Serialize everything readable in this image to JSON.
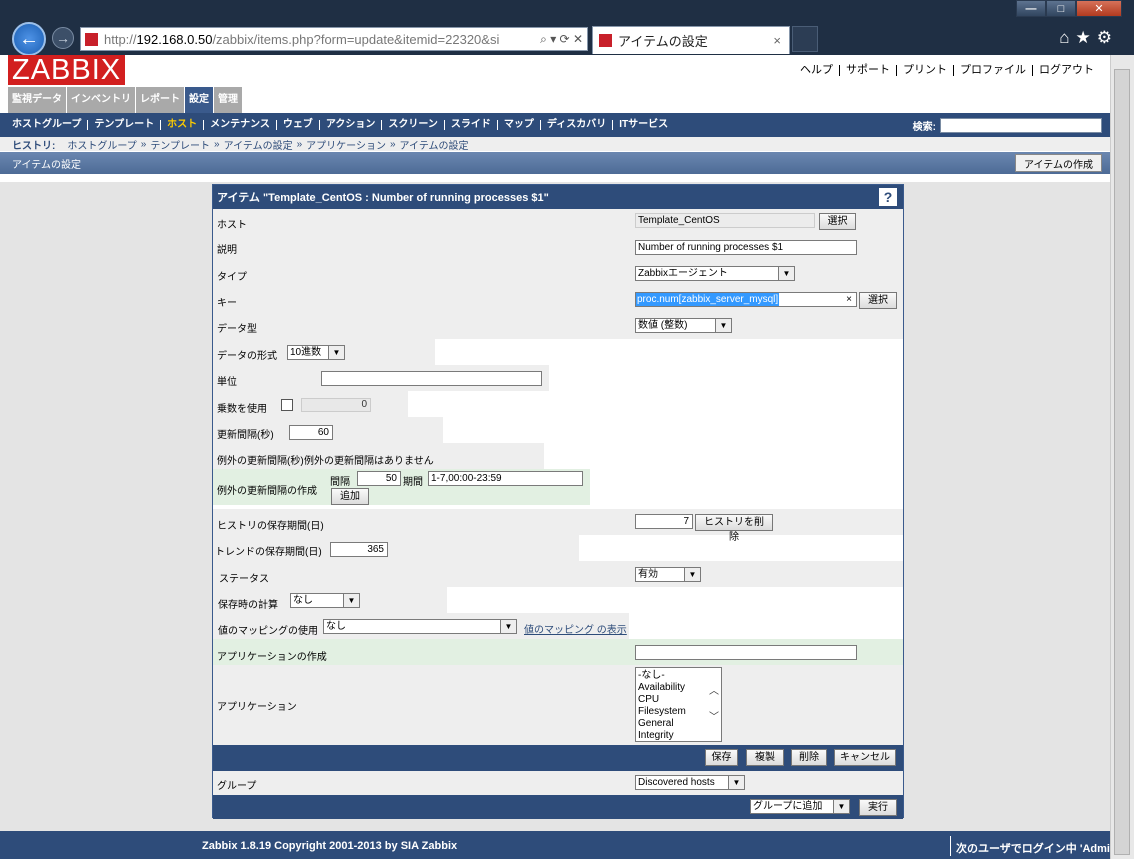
{
  "browser": {
    "url_prefix": "http://",
    "url_host": "192.168.0.50",
    "url_path": "/zabbix/items.php?form=update&itemid=22320&si",
    "tab_title": "アイテムの設定",
    "url_tools": "⌕ ▾ ⟳ ✕",
    "tab_close": "×"
  },
  "window_controls": {
    "min": "—",
    "max": "□",
    "close": "✕"
  },
  "nav_icons": {
    "back": "←",
    "forward": "→",
    "home": "⌂",
    "star": "★",
    "gear": "⚙"
  },
  "app": {
    "logo": "ZABBIX",
    "toplinks": [
      "ヘルプ",
      "サポート",
      "プリント",
      "プロファイル",
      "ログアウト"
    ],
    "maintabs": [
      {
        "label": "監視データ"
      },
      {
        "label": "インベントリ"
      },
      {
        "label": "レポート"
      },
      {
        "label": "設定"
      },
      {
        "label": "管理"
      }
    ],
    "subnav": [
      "ホストグループ",
      "テンプレート",
      "ホスト",
      "メンテナンス",
      "ウェブ",
      "アクション",
      "スクリーン",
      "スライド",
      "マップ",
      "ディスカバリ",
      "ITサービス"
    ],
    "search_label": "検索:",
    "history_label": "ヒストリ:",
    "history": [
      "ホストグループ",
      "テンプレート",
      "アイテムの設定",
      "アプリケーション",
      "アイテムの設定"
    ],
    "history_sep": "»",
    "page_title": "アイテムの設定",
    "create_item_btn": "アイテムの作成"
  },
  "form": {
    "title": "アイテム \"Template_CentOS : Number of running processes $1\"",
    "help": "?",
    "host_label": "ホスト",
    "host_value": "Template_CentOS",
    "select_btn": "選択",
    "desc_label": "説明",
    "desc_value": "Number of running processes $1",
    "type_label": "タイプ",
    "type_value": "Zabbixエージェント",
    "key_label": "キー",
    "key_value": "proc.num[zabbix_server_mysql]",
    "key_clear": "×",
    "datatype_label": "データ型",
    "datatype_value": "数値 (整数)",
    "format_label": "データの形式",
    "format_value": "10進数",
    "unit_label": "単位",
    "unit_value": "",
    "multiplier_label": "乗数を使用",
    "multiplier_value": "0",
    "interval_label": "更新間隔(秒)",
    "interval_value": "60",
    "flex_label": "例外の更新間隔(秒)",
    "flex_none": "例外の更新間隔はありません",
    "flex_create_label": "例外の更新間隔の作成",
    "flex_delay_label": "間隔",
    "flex_delay_value": "50",
    "flex_period_label": "期間",
    "flex_period_value": "1-7,00:00-23:59",
    "add_btn": "追加",
    "history_label": "ヒストリの保存期間(日)",
    "history_value": "7",
    "clear_history_btn": "ヒストリを削除",
    "trends_label": "トレンドの保存期間(日)",
    "trends_value": "365",
    "status_label": "ステータス",
    "status_value": "有効",
    "delta_label": "保存時の計算",
    "delta_value": "なし",
    "valuemap_label": "値のマッピングの使用",
    "valuemap_value": "なし",
    "valuemap_link": "値のマッピング の表示",
    "newapp_label": "アプリケーションの作成",
    "newapp_value": "",
    "apps_label": "アプリケーション",
    "apps": [
      "-なし-",
      "Availability",
      "CPU",
      "Filesystem",
      "General",
      "Integrity"
    ],
    "save_btn": "保存",
    "clone_btn": "複製",
    "delete_btn": "削除",
    "cancel_btn": "キャンセル",
    "group_label": "グループ",
    "group_value": "Discovered hosts",
    "group_action_value": "グループに追加",
    "go_btn": "実行"
  },
  "footer": {
    "copyright": "Zabbix 1.8.19 Copyright 2001-2013 by SIA Zabbix",
    "login": "次のユーザでログイン中 'Admin'"
  }
}
